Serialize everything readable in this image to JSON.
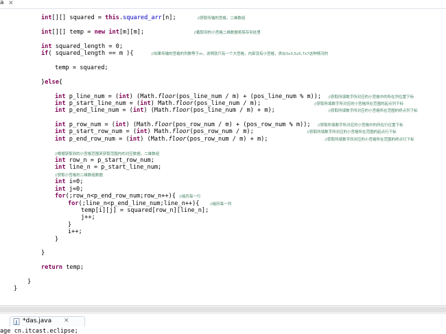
{
  "top_tab": {
    "label": "a",
    "close_glyph": "✕"
  },
  "editor": {
    "lines": [
      [
        {
          "t": "int",
          "c": "kw"
        },
        {
          "t": "[][] squared = "
        },
        {
          "t": "this",
          "c": "kw"
        },
        {
          "t": "."
        },
        {
          "t": "squared_arr",
          "c": "fld"
        },
        {
          "t": "[n];      "
        },
        {
          "t": "//获取传输的宫格，二维数组",
          "c": "cm"
        }
      ],
      [
        {
          "t": "int",
          "c": "kw"
        },
        {
          "t": "[][] temp = "
        },
        {
          "t": "new",
          "c": "kw"
        },
        {
          "t": " "
        },
        {
          "t": "int",
          "c": "kw"
        },
        {
          "t": "[m][m];              "
        },
        {
          "t": "//截取到的小宫格二维数据将保存到这里",
          "c": "cm"
        }
      ],
      [
        {
          "t": "int",
          "c": "kw"
        },
        {
          "t": " squared_length = 0;"
        }
      ],
      [
        {
          "t": "if",
          "c": "kw"
        },
        {
          "t": "( squared_length == m ){     "
        },
        {
          "t": "//如果传输的宫格的列数等于m，说明就只有一个大宫格，内部没有小宫格，类似3x3,5x5,7x7这种情况的",
          "c": "cm"
        }
      ],
      [
        {
          "t": "temp = squared;"
        }
      ],
      [
        {
          "t": "}"
        },
        {
          "t": "else",
          "c": "kw"
        },
        {
          "t": "{"
        }
      ],
      [
        {
          "t": "int",
          "c": "kw"
        },
        {
          "t": " p_line_num = ("
        },
        {
          "t": "int",
          "c": "kw"
        },
        {
          "t": ") (Math."
        },
        {
          "t": "floor",
          "c": "it"
        },
        {
          "t": "(pos_line_num / m) + (pos_line_num % m));  "
        },
        {
          "t": "//获取所填数字所对应的小宫格中的所在列位置下标",
          "c": "cm"
        }
      ],
      [
        {
          "t": "int",
          "c": "kw"
        },
        {
          "t": " p_start_line_num = ("
        },
        {
          "t": "int",
          "c": "kw"
        },
        {
          "t": ") Math."
        },
        {
          "t": "floor",
          "c": "it"
        },
        {
          "t": "(pos_line_num / m);               "
        },
        {
          "t": "//获取所填数字所对应的小宫格所在范围的起点列下标",
          "c": "cm"
        }
      ],
      [
        {
          "t": "int",
          "c": "kw"
        },
        {
          "t": " p_end_line_num = ("
        },
        {
          "t": "int",
          "c": "kw"
        },
        {
          "t": ") (Math."
        },
        {
          "t": "floor",
          "c": "it"
        },
        {
          "t": "(pos_line_num / m) + m);               "
        },
        {
          "t": "//获取所填数字所对应的小宫格所在范围的终点列下标",
          "c": "cm"
        }
      ],
      [
        {
          "t": "int",
          "c": "kw"
        },
        {
          "t": " p_row_num = ("
        },
        {
          "t": "int",
          "c": "kw"
        },
        {
          "t": ") (Math."
        },
        {
          "t": "floor",
          "c": "it"
        },
        {
          "t": "(pos_row_num / m) + (pos_row_num % m));  "
        },
        {
          "t": "//获取所填数字所对应的小宫格中的所在行位置下标",
          "c": "cm"
        }
      ],
      [
        {
          "t": "int",
          "c": "kw"
        },
        {
          "t": " p_start_row_num = ("
        },
        {
          "t": "int",
          "c": "kw"
        },
        {
          "t": ") Math."
        },
        {
          "t": "floor",
          "c": "it"
        },
        {
          "t": "(pos_row_num / m);               "
        },
        {
          "t": "//获取所填数字所对应的小宫格所在范围的起点行下标",
          "c": "cm"
        }
      ],
      [
        {
          "t": "int",
          "c": "kw"
        },
        {
          "t": " p_end_row_num = ("
        },
        {
          "t": "int",
          "c": "kw"
        },
        {
          "t": ") (Math."
        },
        {
          "t": "floor",
          "c": "it"
        },
        {
          "t": "(pos_row_num / m) + m);                "
        },
        {
          "t": "//获取所填数字所对应的小宫格所在范围的终点行下标",
          "c": "cm"
        }
      ],
      [
        {
          "t": "//根据获取到的小宫格范围来获取范围内的对应数据，二维数组",
          "c": "cm"
        }
      ],
      [
        {
          "t": "int",
          "c": "kw"
        },
        {
          "t": " row_n = p_start_row_num;"
        }
      ],
      [
        {
          "t": "int",
          "c": "kw"
        },
        {
          "t": " line_n = p_start_line_num;"
        }
      ],
      [
        {
          "t": "//获取小宫格的二维数组数据",
          "c": "cm"
        }
      ],
      [
        {
          "t": "int",
          "c": "kw"
        },
        {
          "t": " i=0;"
        }
      ],
      [
        {
          "t": "int",
          "c": "kw"
        },
        {
          "t": " j=0;"
        }
      ],
      [
        {
          "t": "for",
          "c": "kw"
        },
        {
          "t": "(;row_n<p_end_row_num;row_n++){ "
        },
        {
          "t": "//遍历每一行",
          "c": "cm"
        }
      ],
      [
        {
          "t": "for",
          "c": "kw"
        },
        {
          "t": "(;line_n<p_end_line_num;line_n++){   "
        },
        {
          "t": "//遍历每一列",
          "c": "cm"
        }
      ],
      [
        {
          "t": "temp[i][j] = squared[row_n][line_n];"
        }
      ],
      [
        {
          "t": "j++;"
        }
      ],
      [
        {
          "t": "}"
        }
      ],
      [
        {
          "t": "i++;"
        }
      ],
      [
        {
          "t": "}"
        }
      ],
      [
        {
          "t": "}"
        }
      ],
      [
        {
          "t": "return",
          "c": "kw"
        },
        {
          "t": " temp;"
        }
      ],
      [
        {
          "t": "}"
        }
      ],
      [
        {
          "t": "}"
        }
      ]
    ]
  },
  "bottom_tab": {
    "label": "*das.java",
    "close_glyph": "✕",
    "icon": "java-file-icon"
  },
  "status": {
    "text": "age cn.itcast.eclipse;"
  },
  "colors": {
    "keyword": "#7f0055",
    "field": "#0000c0",
    "comment": "#3f7f5f"
  }
}
